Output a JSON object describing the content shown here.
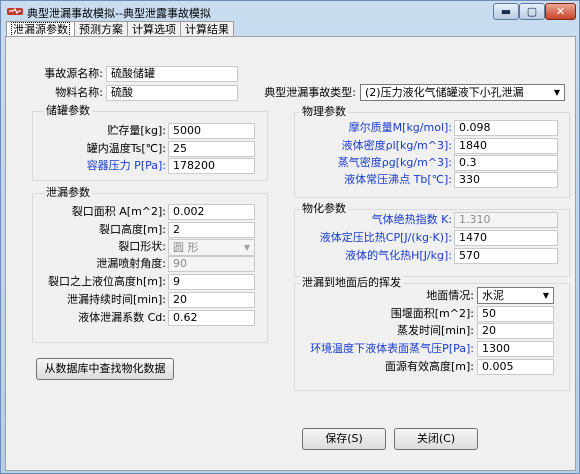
{
  "window": {
    "title": "典型泄漏事故模拟--典型泄露事故模拟"
  },
  "tabs": [
    "泄漏源参数",
    "预测方案",
    "计算选项",
    "计算结果"
  ],
  "source": {
    "name_label": "事故源名称:",
    "name_value": "硫酸储罐",
    "material_label": "物料名称:",
    "material_value": "硫酸"
  },
  "accident_type": {
    "label": "典型泄漏事故类型:",
    "value": "(2)压力液化气储罐液下小孔泄漏"
  },
  "tank": {
    "title": "储罐参数",
    "rows": [
      {
        "label": "贮存量[kg]:",
        "value": "5000"
      },
      {
        "label": "罐内温度Ts[℃]:",
        "value": "25"
      },
      {
        "label": "容器压力 P[Pa]:",
        "value": "178200"
      }
    ]
  },
  "leak": {
    "title": "泄漏参数",
    "area_label": "裂口面积 A[m^2]:",
    "area_value": "0.002",
    "height_label": "裂口高度[m]:",
    "height_value": "2",
    "shape_label": "裂口形状:",
    "shape_value": "圆  形",
    "angle_label": "泄漏喷射角度:",
    "angle_value": "90",
    "level_label": "裂口之上液位高度h[m]:",
    "level_value": "9",
    "duration_label": "泄漏持续时间[min]:",
    "duration_value": "20",
    "coef_label": "液体泄漏系数  Cd:",
    "coef_value": "0.62"
  },
  "physical": {
    "title": "物理参数",
    "rows": [
      {
        "label": "摩尔质量M[kg/mol]:",
        "value": "0.098"
      },
      {
        "label": "液体密度ρl[kg/m^3]:",
        "value": "1840"
      },
      {
        "label": "蒸气密度ρg[kg/m^3]:",
        "value": "0.3"
      },
      {
        "label": "液体常压沸点 Tb[℃]:",
        "value": "330"
      }
    ]
  },
  "physchem": {
    "title": "物化参数",
    "rows": [
      {
        "label": "气体绝热指数  K:",
        "value": "1.310"
      },
      {
        "label": "液体定压比热CP[J/(kg·K)]:",
        "value": "1470"
      },
      {
        "label": "液体的气化热H[J/kg]:",
        "value": "570"
      }
    ]
  },
  "evaporation": {
    "title": "泄漏到地面后的挥发",
    "ground_label": "地面情况:",
    "ground_value": "水泥",
    "area_label": "围堰面积[m^2]:",
    "area_value": "50",
    "time_label": "蒸发时间[min]:",
    "time_value": "20",
    "vapor_label": "环境温度下液体表面蒸气压P[Pa]:",
    "vapor_value": "1300",
    "height_label": "面源有效高度[m]:",
    "height_value": "0.005"
  },
  "buttons": {
    "db": "从数据库中查找物化数据",
    "save": "保存(S)",
    "close": "关闭(C)"
  },
  "colors": {
    "emphasis_label": "#1a3bd1",
    "window_frame": "#bcd5ee",
    "panel": "#f0f0f0"
  }
}
